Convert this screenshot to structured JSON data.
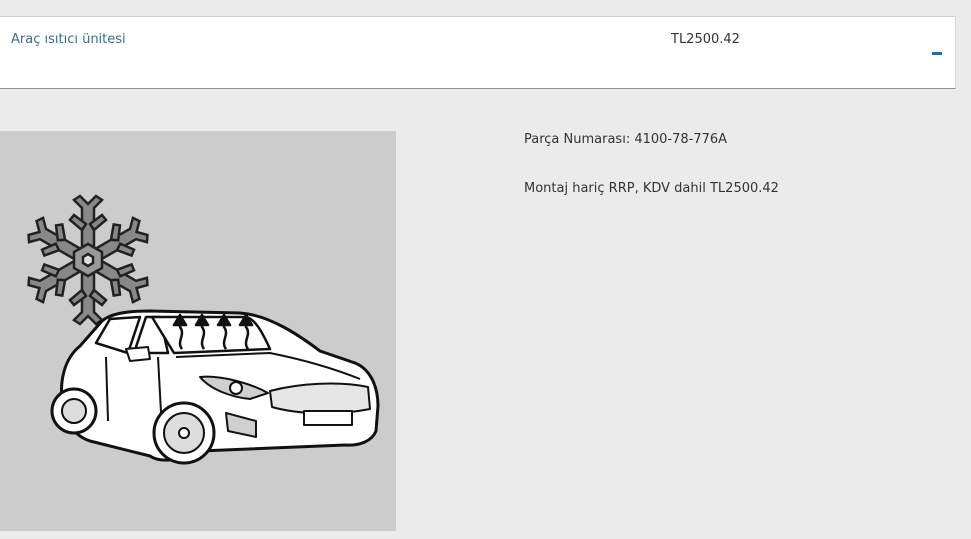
{
  "item": {
    "title": "Araç ısıtıcı ünitesi",
    "price": "TL2500.42",
    "toggle_icon": "minus-icon"
  },
  "details": {
    "part_number_label": "Parça Numarası:",
    "part_number": "4100-78-776A",
    "price_note_label": "Montaj hariç RRP, KDV dahil",
    "price_note_value": "TL2500.42"
  },
  "image": {
    "icon": "car-heater-snowflake-illustration",
    "background": "#cccccc"
  },
  "colors": {
    "link": "#3a6f8c",
    "accent": "#1a73a8",
    "page_background": "#ebebeb"
  }
}
